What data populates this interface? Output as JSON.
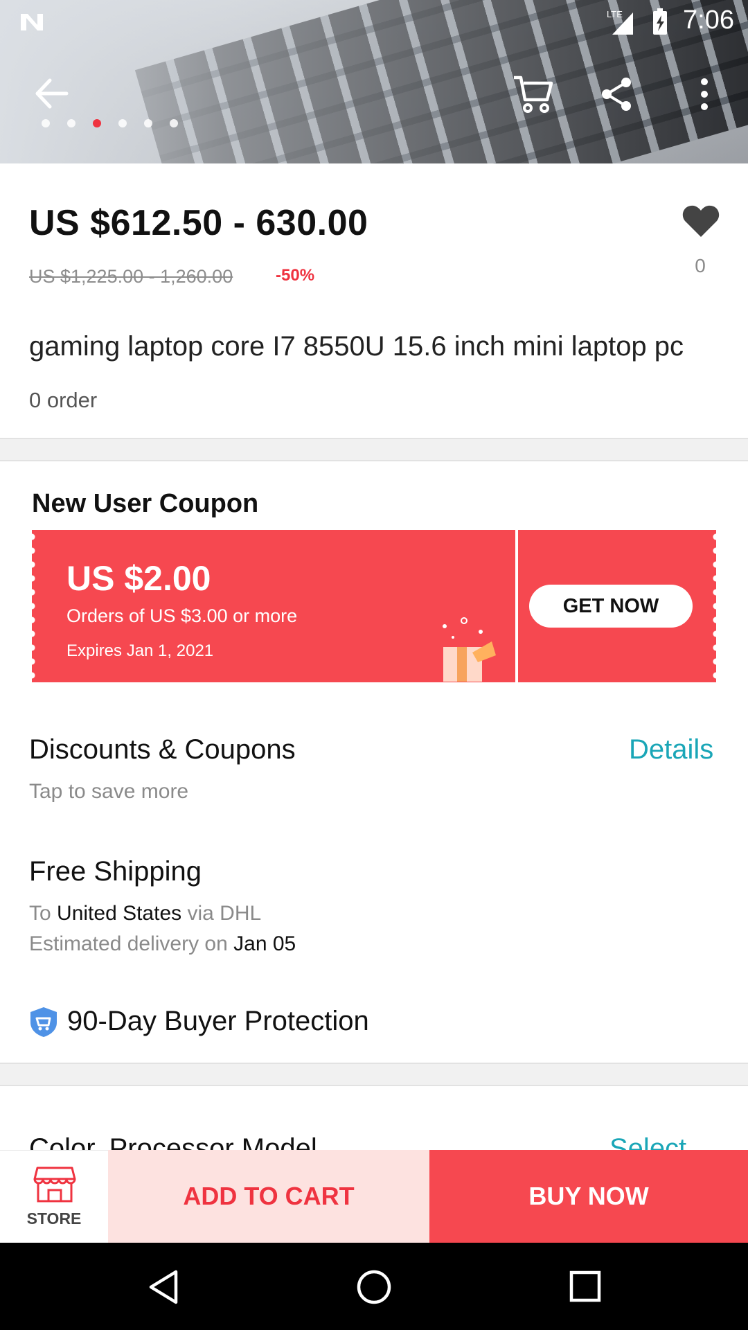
{
  "status_bar": {
    "time": "7:06",
    "network": "LTE"
  },
  "header": {
    "image_dots": 6,
    "active_dot": 3
  },
  "product": {
    "price": "US $612.50 - 630.00",
    "original_price": "US $1,225.00 - 1,260.00",
    "discount": "-50%",
    "favorites": "0",
    "title": "gaming laptop core I7 8550U 15.6 inch mini laptop pc",
    "orders": "0 order"
  },
  "coupon": {
    "heading": "New User Coupon",
    "amount": "US $2.00",
    "condition": "Orders of US $3.00 or more",
    "expires": "Expires Jan 1, 2021",
    "button": "GET NOW",
    "color": "#f64850"
  },
  "discounts": {
    "title": "Discounts & Coupons",
    "subtitle": "Tap to save more",
    "link": "Details"
  },
  "shipping": {
    "title": "Free Shipping",
    "to_label": "To",
    "destination": "United States",
    "via": "via DHL",
    "delivery_label": "Estimated delivery on",
    "delivery_date": "Jan 05"
  },
  "protection": {
    "label": "90-Day Buyer Protection"
  },
  "variant": {
    "title": "Color, Processor Model",
    "link": "Select"
  },
  "bottom_bar": {
    "store": "STORE",
    "add_to_cart": "ADD TO CART",
    "buy_now": "BUY NOW"
  },
  "colors": {
    "accent": "#ef3340",
    "link": "#1aa6b7",
    "cart_bg": "#fde2e0"
  },
  "icons": [
    "back-arrow-icon",
    "cart-icon",
    "share-icon",
    "more-vert-icon",
    "heart-icon",
    "shield-icon",
    "store-icon",
    "nav-back-icon",
    "nav-home-icon",
    "nav-recents-icon"
  ]
}
